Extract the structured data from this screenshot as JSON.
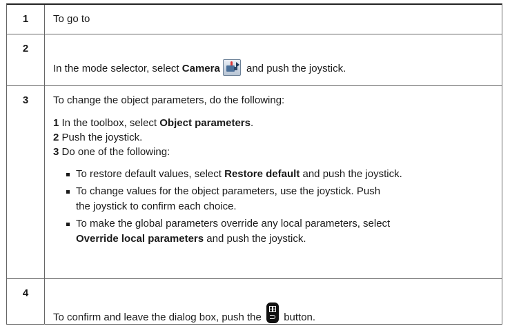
{
  "rows": [
    {
      "num": "1",
      "text": "To go to"
    },
    {
      "num": "2",
      "pre": "In the mode selector, select ",
      "bold": "Camera",
      "post": " and push the joystick.",
      "icon": "camera-mode-icon"
    },
    {
      "num": "3",
      "intro": "To change the object parameters, do the following:",
      "steps": [
        {
          "n": "1",
          "pre": " In the toolbox, select ",
          "bold": "Object parameters",
          "post": "."
        },
        {
          "n": "2",
          "text": " Push the joystick."
        },
        {
          "n": "3",
          "text": " Do one of the following:"
        }
      ],
      "bullets": [
        {
          "pre": "To restore default values, select ",
          "bold": "Restore default",
          "post": " and push the joystick."
        },
        {
          "line1": "To change values for the object parameters, use the joystick. Push",
          "line2": "the joystick to confirm each choice."
        },
        {
          "line1": "To make the global parameters override any local parameters, select",
          "bold": "Override local parameters",
          "post": " and push the joystick."
        }
      ]
    },
    {
      "num": "4",
      "pre": "To confirm and leave the dialog box, push the ",
      "post": " button.",
      "icon": "menu-back-button-icon"
    }
  ]
}
